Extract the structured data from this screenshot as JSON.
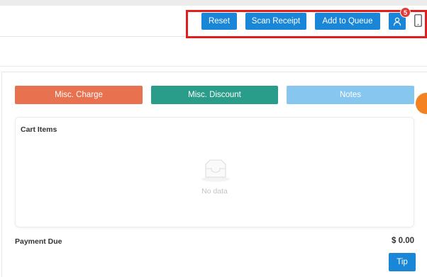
{
  "header": {
    "reset_label": "Reset",
    "scan_receipt_label": "Scan Receipt",
    "add_to_queue_label": "Add to Queue",
    "user_badge_count": "5",
    "user_icon": "user-icon",
    "device_icon": "tablet-icon"
  },
  "actions": {
    "misc_charge_label": "Misc. Charge",
    "misc_discount_label": "Misc. Discount",
    "notes_label": "Notes"
  },
  "cart": {
    "title": "Cart Items",
    "empty_text": "No data"
  },
  "payment": {
    "label": "Payment Due",
    "amount": "$ 0.00",
    "tip_label": "Tip"
  },
  "colors": {
    "primary": "#1a86d8",
    "misc_charge": "#e8714f",
    "misc_discount": "#2a9d8a",
    "notes": "#86c6ef",
    "highlight": "#e01e1e",
    "badge": "#e53935"
  }
}
